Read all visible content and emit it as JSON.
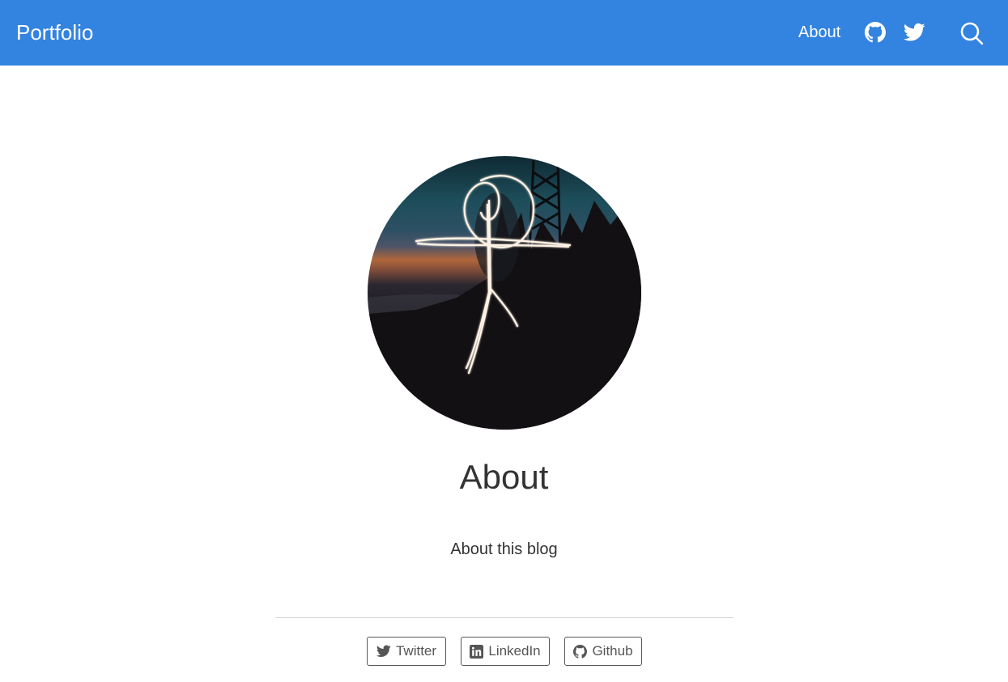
{
  "navbar": {
    "brand": "Portfolio",
    "about_link": "About",
    "icons": [
      "github-icon",
      "twitter-icon",
      "search-icon"
    ],
    "background_color": "#3383e0"
  },
  "main": {
    "title": "About",
    "subtitle": "About this blog"
  },
  "social_links": [
    {
      "label": "Twitter",
      "icon": "twitter-icon"
    },
    {
      "label": "LinkedIn",
      "icon": "linkedin-icon"
    },
    {
      "label": "Github",
      "icon": "github-icon"
    }
  ]
}
